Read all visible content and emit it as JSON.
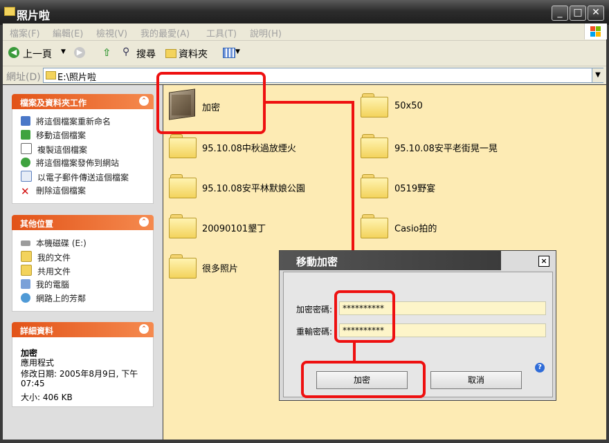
{
  "window": {
    "title": "照片啦"
  },
  "menu": [
    "檔案(F)",
    "編輯(E)",
    "檢視(V)",
    "我的最愛(A)",
    "工具(T)",
    "說明(H)"
  ],
  "toolbar": {
    "back": "上一頁",
    "search": "搜尋",
    "folders": "資料夾"
  },
  "address": {
    "label": "網址(D)",
    "path": "E:\\照片啦"
  },
  "panels": {
    "tasks": {
      "title": "檔案及資料夾工作",
      "items": [
        "將這個檔案重新命名",
        "移動這個檔案",
        "複製這個檔案",
        "將這個檔案發佈到網站",
        "以電子郵件傳送這個檔案",
        "刪除這個檔案"
      ]
    },
    "places": {
      "title": "其他位置",
      "items": [
        "本機磁碟 (E:)",
        "我的文件",
        "共用文件",
        "我的電腦",
        "網路上的芳鄰"
      ]
    },
    "details": {
      "title": "詳細資料",
      "name": "加密",
      "type": "應用程式",
      "modified": "修改日期: 2005年8月9日, 下午 07:45",
      "size": "大小: 406 KB"
    }
  },
  "files": [
    "加密",
    "50x50",
    "95.10.08中秋過放煙火",
    "95.10.08安平老街晃一晃",
    "95.10.08安平林默娘公園",
    "0519野宴",
    "20090101墾丁",
    "Casio拍的",
    "很多照片"
  ],
  "dialog": {
    "title": "移動加密",
    "password_label": "加密密碼:",
    "password_value": "**********",
    "confirm_label": "重輸密碼:",
    "confirm_value": "**********",
    "ok": "加密",
    "cancel": "取消",
    "help": "?",
    "close": "×"
  },
  "colors": {
    "annotation": "#ee1010",
    "panel_header": "#e25318",
    "pane_bg": "#fdebb4"
  }
}
